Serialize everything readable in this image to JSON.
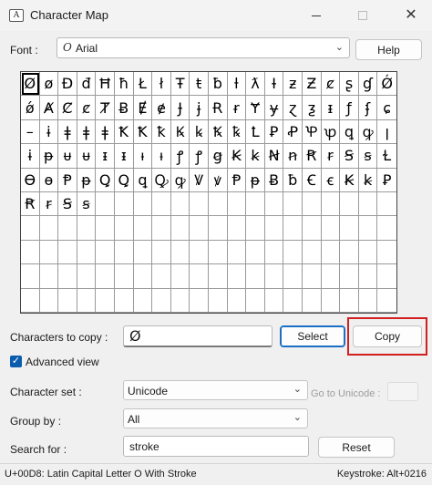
{
  "window": {
    "title": "Character Map",
    "minimize": "minimize",
    "maximize": "maximize",
    "close": "close"
  },
  "font": {
    "label": "Font :",
    "value": "Arial",
    "icon": "font-type-icon"
  },
  "buttons": {
    "help": "Help",
    "select": "Select",
    "copy": "Copy",
    "reset": "Reset"
  },
  "grid": {
    "columns": 20,
    "rows": 10,
    "selected_index": 0,
    "characters": [
      "Ø",
      "ø",
      "Đ",
      "đ",
      "Ħ",
      "ħ",
      "Ł",
      "ł",
      "Ŧ",
      "ŧ",
      "ƀ",
      "ƚ",
      "ƛ",
      "Ɨ",
      "ƶ",
      "Ƶ",
      "ȼ",
      "ʂ",
      "ɠ",
      "Ǿ",
      "ǿ",
      "Ⱥ",
      "Ȼ",
      "ȼ",
      "Ⱦ",
      "Ƀ",
      "Ɇ",
      "ɇ",
      "Ɉ",
      "ɉ",
      "Ɍ",
      "ɍ",
      "Ɏ",
      "ɏ",
      "ɀ",
      "ƺ",
      "ᵻ",
      "ƒ",
      "ʄ",
      "ɕ",
      "–",
      "ɨ",
      "ǂ",
      "ǂ",
      "ǂ",
      "Ꝁ",
      "Ꝁ",
      "ꝁ",
      "Ꝃ",
      "ꝃ",
      "Ꝅ",
      "ꝅ",
      "Ꝉ",
      "Ꝑ",
      "Ꝓ",
      "Ꝕ",
      "ꝕ",
      "ꝗ",
      "ꝙ",
      "ꞁ",
      "ɨ",
      "ᵽ",
      "ᵾ",
      "ᵾ",
      "ᵻ",
      "ᵻ",
      "ᵼ",
      "ᵼ",
      "ꝭ",
      "ꝭ",
      "ꞡ",
      "Ꞣ",
      "ꞣ",
      "Ꞥ",
      "ꞥ",
      "Ꞧ",
      "ꞧ",
      "Ꞩ",
      "ꞩ",
      "Ɫ",
      "Ɵ",
      "ɵ",
      "Ᵽ",
      "ᵽ",
      "Ꝗ",
      "Ꝗ",
      "ꝗ",
      "Ꝙ",
      "ꝙ",
      "Ꝟ",
      "ꝟ",
      "Ᵽ",
      "ᵽ",
      "Ƀ",
      "ƀ",
      "Ꞓ",
      "ꞓ",
      "Ꞣ",
      "ꞣ",
      "Ꝑ",
      "Ꞧ",
      "ꞧ",
      "Ꞩ",
      "ꞩ",
      "",
      "",
      "",
      "",
      "",
      "",
      "",
      "",
      "",
      "",
      "",
      "",
      "",
      "",
      "",
      "",
      "",
      "",
      "",
      "",
      "",
      "",
      "",
      "",
      "",
      "",
      "",
      "",
      "",
      "",
      "",
      "",
      "",
      "",
      "",
      "",
      "",
      "",
      "",
      "",
      "",
      "",
      "",
      "",
      "",
      "",
      "",
      "",
      "",
      "",
      "",
      "",
      "",
      "",
      "",
      "",
      "",
      "",
      "",
      "",
      "",
      "",
      "",
      "",
      "",
      "",
      "",
      "",
      "",
      "",
      "",
      "",
      "",
      "",
      "",
      "",
      "",
      "",
      "",
      "",
      "",
      "",
      "",
      "",
      "",
      "",
      "",
      "",
      "",
      "",
      "",
      "",
      "",
      "",
      "",
      ""
    ]
  },
  "copy": {
    "label": "Characters to copy :",
    "value": "Ø"
  },
  "advanced": {
    "label": "Advanced view",
    "checked": true,
    "check_glyph": "✓"
  },
  "character_set": {
    "label": "Character set :",
    "value": "Unicode"
  },
  "goto_unicode": {
    "label": "Go to Unicode :"
  },
  "group_by": {
    "label": "Group by :",
    "value": "All"
  },
  "search": {
    "label": "Search for :",
    "value": "stroke"
  },
  "status": {
    "left": "U+00D8: Latin Capital Letter O With Stroke",
    "right": "Keystroke: Alt+0216"
  },
  "icons": {
    "chevron": "⌄",
    "close": "✕",
    "app": "A"
  }
}
